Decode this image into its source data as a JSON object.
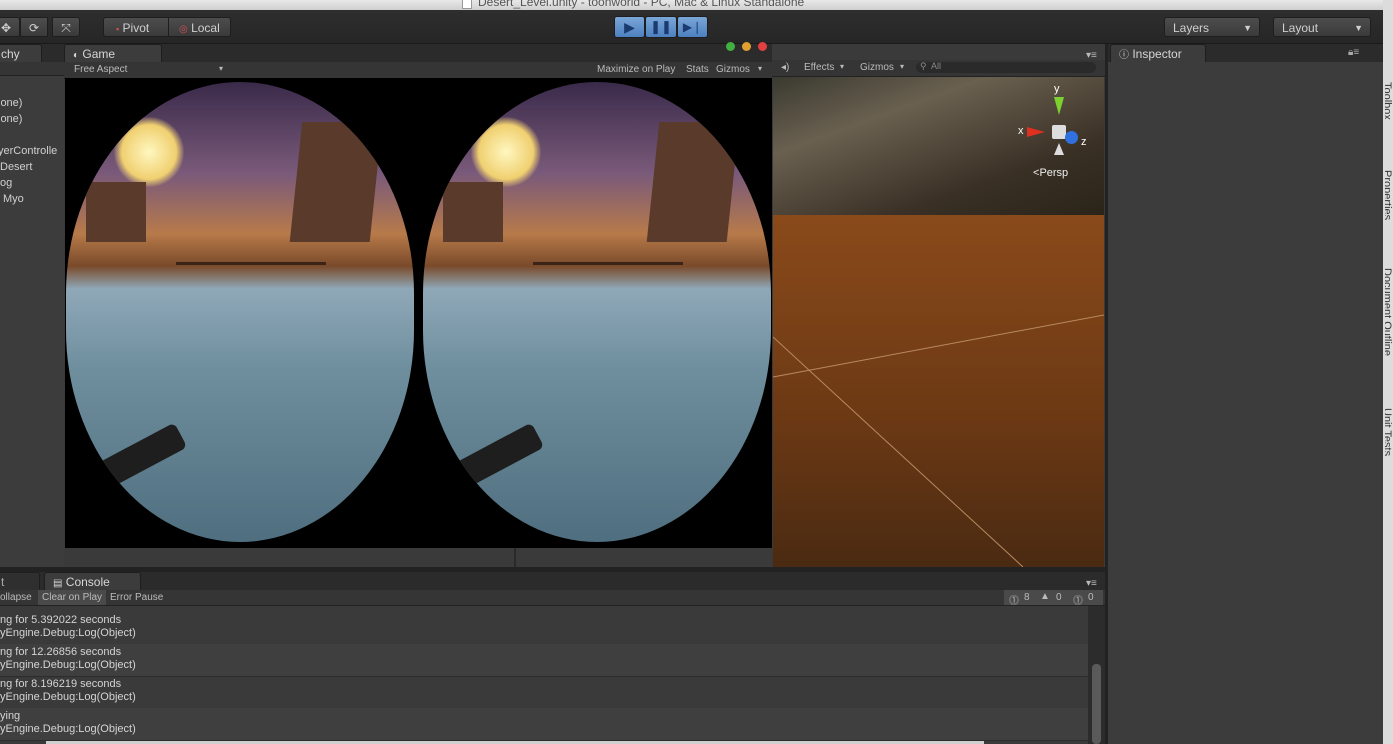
{
  "window": {
    "title": "Desert_Level.unity - toonworld - PC, Mac & Linux Standalone"
  },
  "toolbar": {
    "pivot_label": "Pivot",
    "local_label": "Local",
    "layers_label": "Layers",
    "layout_label": "Layout"
  },
  "hierarchy": {
    "tab_label": "chy",
    "items": [
      "lone)",
      "lone)",
      "yerControlle",
      "Desert",
      "og",
      "Myo"
    ]
  },
  "game": {
    "tab_label": "Game",
    "aspect_label": "Free Aspect",
    "maximize_label": "Maximize on Play",
    "stats_label": "Stats",
    "gizmos_label": "Gizmos"
  },
  "scene": {
    "effects_label": "Effects",
    "gizmos_label": "Gizmos",
    "search_placeholder": "All",
    "persp_label": "Persp",
    "axis_x": "x",
    "axis_y": "y",
    "axis_z": "z"
  },
  "inspector": {
    "tab_label": "Inspector"
  },
  "console": {
    "tab_label": "Console",
    "left_tab_label": "t",
    "collapse_label": "ollapse",
    "clear_on_play_label": "Clear on Play",
    "error_pause_label": "Error Pause",
    "error_count": "8",
    "warning_count": "0",
    "info_count": "0",
    "entries": [
      {
        "line1": "ng for 5.392022 seconds",
        "line2": "yEngine.Debug:Log(Object)"
      },
      {
        "line1": "ng for 12.26856 seconds",
        "line2": "yEngine.Debug:Log(Object)"
      },
      {
        "line1": "ng for 8.196219 seconds",
        "line2": "yEngine.Debug:Log(Object)"
      },
      {
        "line1": "ying",
        "line2": "yEngine.Debug:Log(Object)"
      }
    ]
  },
  "side_tabs": [
    "Toolbox",
    "Properties",
    "Document Outline",
    "Unit Tests"
  ],
  "colors": {
    "play_active": "#4d80c0",
    "error_dot": "#e04040",
    "minimize_dot": "#e0a030",
    "zoom_dot": "#40b040"
  }
}
